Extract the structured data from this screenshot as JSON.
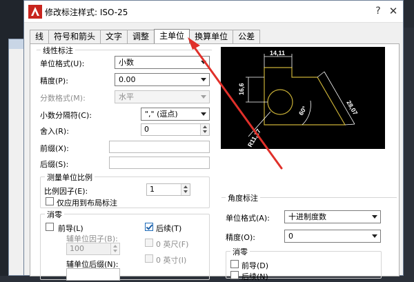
{
  "dialog": {
    "title": "修改标注样式: ISO-25",
    "help_glyph": "?",
    "close_glyph": "✕"
  },
  "tabs": [
    {
      "label": "线"
    },
    {
      "label": "符号和箭头"
    },
    {
      "label": "文字"
    },
    {
      "label": "调整"
    },
    {
      "label": "主单位",
      "active": true
    },
    {
      "label": "换算单位"
    },
    {
      "label": "公差"
    }
  ],
  "linear": {
    "title": "线性标注",
    "unit_format": {
      "label": "单位格式(U):",
      "value": "小数"
    },
    "precision": {
      "label": "精度(P):",
      "value": "0.00"
    },
    "fraction_format": {
      "label": "分数格式(M):",
      "value": "水平"
    },
    "decimal_separator": {
      "label": "小数分隔符(C):",
      "value": "\",\" (逗点)"
    },
    "round_off": {
      "label": "舍入(R):",
      "value": "0"
    },
    "prefix": {
      "label": "前缀(X):",
      "value": ""
    },
    "suffix": {
      "label": "后缀(S):",
      "value": ""
    }
  },
  "scale": {
    "title": "测量单位比例",
    "factor": {
      "label": "比例因子(E):",
      "value": "1"
    },
    "layout_only": {
      "label": "仅应用到布局标注",
      "checked": false
    }
  },
  "zero_linear": {
    "title": "消零",
    "leading": {
      "label": "前导(L)",
      "checked": false
    },
    "trailing": {
      "label": "后续(T)",
      "checked": true
    },
    "sub_factor": {
      "label": "辅单位因子(B):",
      "value": "100"
    },
    "feet": {
      "label": "0 英尺(F)",
      "checked": false
    },
    "sub_suffix": {
      "label": "辅单位后缀(N):",
      "value": ""
    },
    "inches": {
      "label": "0 英寸(I)",
      "checked": false
    }
  },
  "preview": {
    "dims": [
      "14,11",
      "16,6",
      "28,07",
      "60°",
      "R11,17"
    ]
  },
  "angular": {
    "title": "角度标注",
    "unit_format": {
      "label": "单位格式(A):",
      "value": "十进制度数"
    },
    "precision": {
      "label": "精度(O):",
      "value": "0"
    },
    "zero_title": "消零",
    "leading": {
      "label": "前导(D)",
      "checked": false
    },
    "trailing": {
      "label": "后续(N)",
      "checked": false
    }
  },
  "colors": {
    "annotation_arrow": "#e0302a",
    "preview_geometry": "#c9b037",
    "preview_dims": "#ffffff"
  }
}
